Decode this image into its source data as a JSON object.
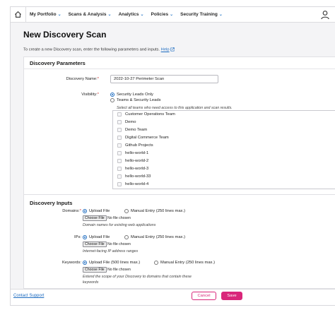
{
  "nav": {
    "items": [
      {
        "label": "My Portfolio"
      },
      {
        "label": "Scans & Analysis"
      },
      {
        "label": "Analytics"
      },
      {
        "label": "Policies"
      },
      {
        "label": "Security Training"
      }
    ]
  },
  "page": {
    "title": "New Discovery Scan",
    "intro": "To create a new Discovery scan, enter the following parameters and inputs.",
    "help_link": "Help"
  },
  "parameters": {
    "heading": "Discovery Parameters",
    "name_label": "Discovery Name:",
    "name_value": "2022-10-27 Perimeter Scan",
    "visibility_label": "Visibility:",
    "visibility_options": [
      "Security Leads Only",
      "Teams & Security Leads"
    ],
    "teams_hint": "Select all teams who need access to this application and scan results.",
    "teams": [
      "Customer Operations Team",
      "Demo",
      "Demo Team",
      "Digital Commerce Team",
      "Github Projects",
      "hello-world-1",
      "hello-world-2",
      "hello-world-3",
      "hello-world-33",
      "hello-world-4"
    ]
  },
  "inputs": {
    "heading": "Discovery Inputs",
    "domains": {
      "label": "Domains:",
      "upload": "Upload File",
      "manual": "Manual Entry (250 lines max.)",
      "choose": "Choose File",
      "no_file": "No file chosen",
      "hint": "Domain names for existing web applications"
    },
    "ips": {
      "label": "IPs:",
      "upload": "Upload File",
      "manual": "Manual Entry (250 lines max.)",
      "choose": "Choose File",
      "no_file": "No file chosen",
      "hint": "Internet-facing IP address ranges"
    },
    "keywords": {
      "label": "Keywords:",
      "upload": "Upload File (500 lines max.)",
      "manual": "Manual Entry (250 lines max.)",
      "choose": "Choose File",
      "no_file": "No file chosen",
      "hint_1": "Extend the scope of your Discovery to domains that contain these",
      "hint_2": "keywords"
    }
  },
  "footer": {
    "support": "Contact Support",
    "cancel": "Cancel",
    "save": "Save"
  },
  "colors": {
    "accent": "#d9267a",
    "link": "#1c6bc0"
  }
}
